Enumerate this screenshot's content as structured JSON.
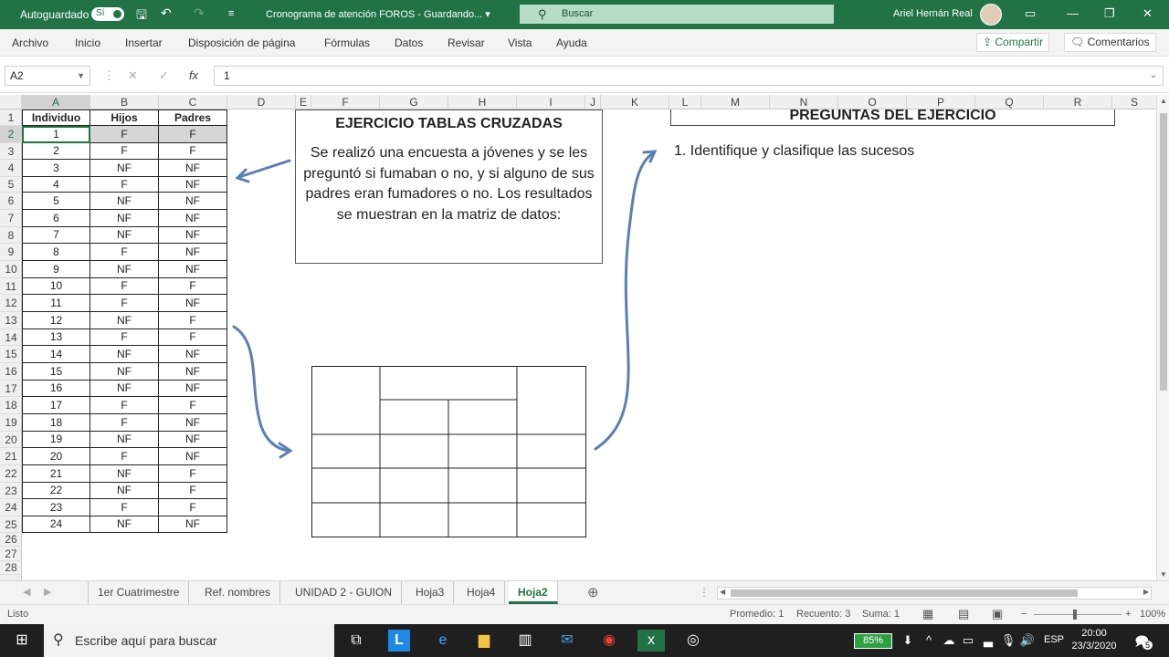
{
  "titlebar": {
    "autosave_label": "Autoguardado",
    "autosave_toggle": "Sí",
    "doc_title": "Cronograma de atención FOROS  -  Guardando... ▾",
    "search_placeholder": "Buscar",
    "user_name": "Ariel Hernán Real"
  },
  "menu": [
    "Archivo",
    "Inicio",
    "Insertar",
    "Disposición de página",
    "Fórmulas",
    "Datos",
    "Revisar",
    "Vista",
    "Ayuda"
  ],
  "share_label": "Compartir",
  "comments_label": "Comentarios",
  "namebox": "A2",
  "formula_value": "1",
  "columns": [
    "A",
    "B",
    "C",
    "D",
    "E",
    "F",
    "G",
    "H",
    "I",
    "J",
    "K",
    "L",
    "M",
    "N",
    "O",
    "P",
    "Q",
    "R",
    "S"
  ],
  "rows": [
    "1",
    "2",
    "3",
    "4",
    "5",
    "6",
    "7",
    "8",
    "9",
    "10",
    "11",
    "12",
    "13",
    "14",
    "15",
    "16",
    "17",
    "18",
    "19",
    "20",
    "21",
    "22",
    "23",
    "24",
    "25",
    "26",
    "27",
    "28"
  ],
  "table": {
    "headers": [
      "Individuo",
      "Hijos",
      "Padres"
    ],
    "data": [
      [
        "1",
        "F",
        "F"
      ],
      [
        "2",
        "F",
        "F"
      ],
      [
        "3",
        "NF",
        "NF"
      ],
      [
        "4",
        "F",
        "NF"
      ],
      [
        "5",
        "NF",
        "NF"
      ],
      [
        "6",
        "NF",
        "NF"
      ],
      [
        "7",
        "NF",
        "NF"
      ],
      [
        "8",
        "F",
        "NF"
      ],
      [
        "9",
        "NF",
        "NF"
      ],
      [
        "10",
        "F",
        "F"
      ],
      [
        "11",
        "F",
        "NF"
      ],
      [
        "12",
        "NF",
        "F"
      ],
      [
        "13",
        "F",
        "F"
      ],
      [
        "14",
        "NF",
        "NF"
      ],
      [
        "15",
        "NF",
        "NF"
      ],
      [
        "16",
        "NF",
        "NF"
      ],
      [
        "17",
        "F",
        "F"
      ],
      [
        "18",
        "F",
        "NF"
      ],
      [
        "19",
        "NF",
        "NF"
      ],
      [
        "20",
        "F",
        "NF"
      ],
      [
        "21",
        "NF",
        "F"
      ],
      [
        "22",
        "NF",
        "F"
      ],
      [
        "23",
        "F",
        "F"
      ],
      [
        "24",
        "NF",
        "NF"
      ]
    ]
  },
  "exercise_box": {
    "title": "EJERCICIO TABLAS CRUZADAS",
    "text": "Se realizó una encuesta a jóvenes y se les preguntó si fumaban o no, y si alguno de sus padres eran fumadores o no.  Los resultados se muestran en la matriz de datos:"
  },
  "questions_box": {
    "title": "PREGUNTAS DEL EJERCICIO",
    "q1": "1. Identifique y clasifique las sucesos"
  },
  "sheet_tabs": [
    "1er Cuatrimestre",
    "Ref. nombres",
    "UNIDAD 2 - GUION",
    "Hoja3",
    "Hoja4",
    "Hoja2"
  ],
  "active_sheet": "Hoja2",
  "status": {
    "ready": "Listo",
    "promedio": "Promedio: 1",
    "recuento": "Recuento: 3",
    "suma": "Suma: 1",
    "zoom": "100%"
  },
  "taskbar": {
    "search_placeholder": "Escribe aquí para buscar",
    "battery": "85%",
    "lang": "ESP",
    "time": "20:00",
    "date": "23/3/2020",
    "notif_count": "5"
  },
  "colors": {
    "excel_green": "#217346",
    "arrow_blue": "#5b7fb3"
  }
}
